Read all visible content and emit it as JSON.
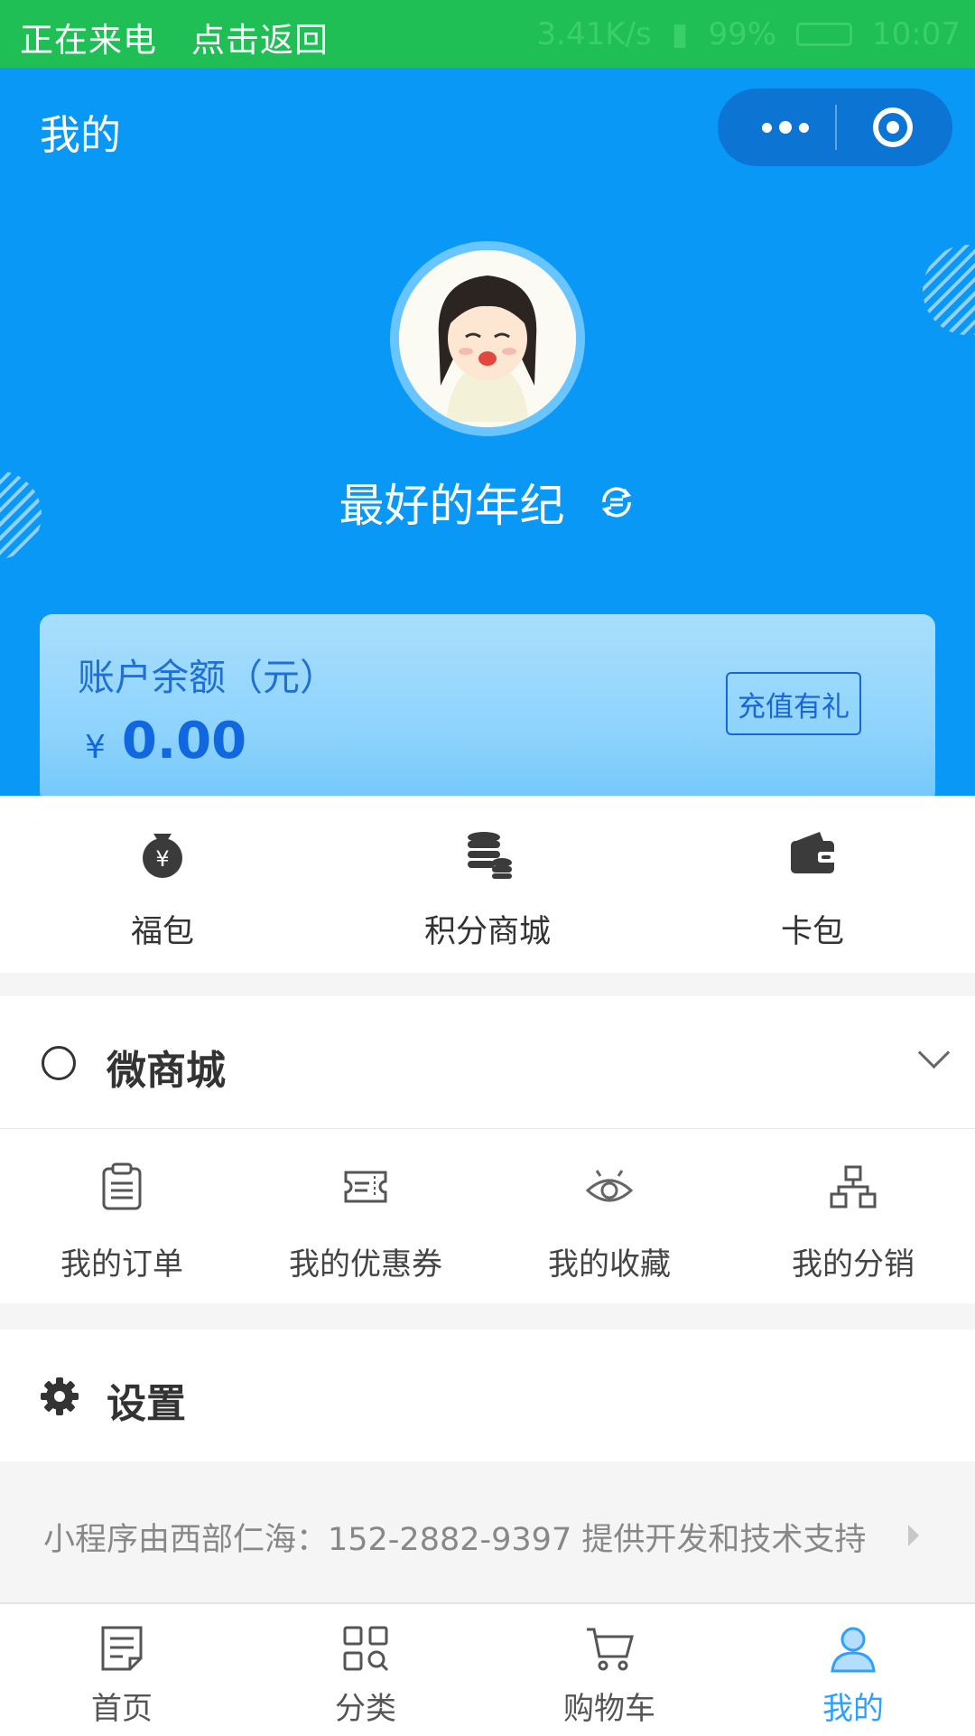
{
  "status_bar": {
    "call_text": "正在来电",
    "return_text": "点击返回",
    "speed": "3.41K/s",
    "battery": "99%",
    "time": "10:07"
  },
  "header": {
    "title": "我的",
    "username": "最好的年纪"
  },
  "balance": {
    "label": "账户余额（元）",
    "currency": "¥",
    "amount": "0.00",
    "recharge_label": "充值有礼"
  },
  "wallet": {
    "items": [
      {
        "label": "福包",
        "icon": "money-bag-icon"
      },
      {
        "label": "积分商城",
        "icon": "coin-stack-icon"
      },
      {
        "label": "卡包",
        "icon": "wallet-icon"
      }
    ]
  },
  "mall": {
    "title": "微商城",
    "items": [
      {
        "label": "我的订单",
        "icon": "clipboard-icon"
      },
      {
        "label": "我的优惠券",
        "icon": "coupon-icon"
      },
      {
        "label": "我的收藏",
        "icon": "eye-icon"
      },
      {
        "label": "我的分销",
        "icon": "hierarchy-icon"
      }
    ]
  },
  "settings": {
    "title": "设置"
  },
  "support": {
    "text": "小程序由西部仁海：152-2882-9397 提供开发和技术支持"
  },
  "tabbar": {
    "tabs": [
      {
        "label": "首页",
        "icon": "document-icon"
      },
      {
        "label": "分类",
        "icon": "category-icon"
      },
      {
        "label": "购物车",
        "icon": "cart-icon"
      },
      {
        "label": "我的",
        "icon": "user-icon"
      }
    ],
    "active_color": "#2ea0ff"
  },
  "colors": {
    "status_bar": "#20bf55",
    "header_bg": "#0a98f6",
    "brand_blue": "#1067e0"
  }
}
